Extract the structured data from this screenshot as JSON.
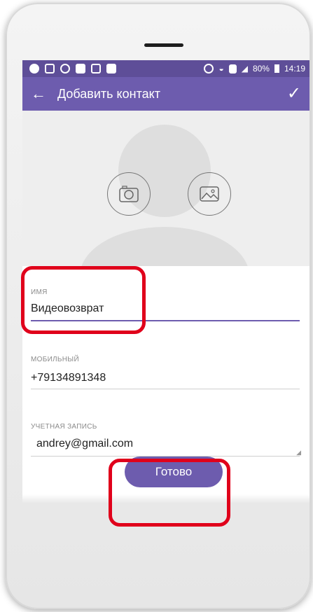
{
  "status_bar": {
    "battery": "80%",
    "time": "14:19",
    "icons": [
      "skype-icon",
      "gallery-icon",
      "whatsapp-icon",
      "message-icon",
      "instagram-icon",
      "sticker-icon",
      "alarm-icon",
      "wifi-icon",
      "sim-icon",
      "signal-icon",
      "battery-icon"
    ]
  },
  "app_bar": {
    "title": "Добавить контакт",
    "back_icon": "←",
    "confirm_icon": "✓"
  },
  "photo": {
    "camera_button": "camera-icon",
    "gallery_button": "image-icon"
  },
  "form": {
    "name_label": "ИМЯ",
    "name_value": "Видеовозврат",
    "mobile_label": "МОБИЛЬНЫЙ",
    "mobile_value": "+79134891348",
    "account_label": "УЧЕТНАЯ ЗАПИСЬ",
    "account_value": "andrey@gmail.com"
  },
  "done_button": "Готово",
  "colors": {
    "status_bar": "#5e4e98",
    "app_bar": "#6d5cae",
    "button": "#6d5cae",
    "highlight": "#e0001b",
    "photo_area": "#eeeeee"
  }
}
